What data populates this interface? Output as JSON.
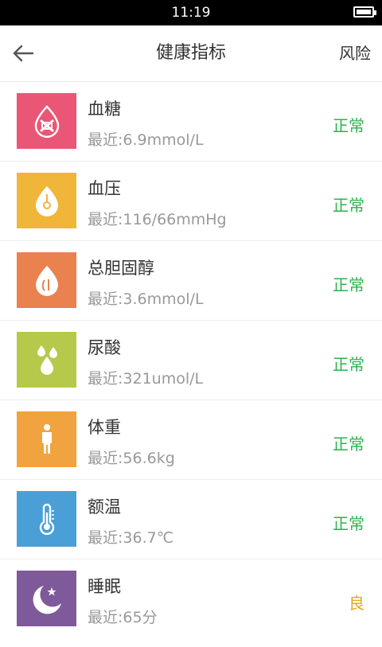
{
  "status_bar": {
    "time": "11:19"
  },
  "header": {
    "title": "健康指标",
    "right_action": "风险"
  },
  "colors": {
    "normal": "#2bb24c",
    "good": "#e6a817"
  },
  "items": [
    {
      "name": "血糖",
      "recent": "最近:6.9mmol/L",
      "status": "正常",
      "tile_color": "#ea5675",
      "icon": "blood-sugar-icon"
    },
    {
      "name": "血压",
      "recent": "最近:116/66mmHg",
      "status": "正常",
      "tile_color": "#f0b63a",
      "icon": "blood-pressure-icon"
    },
    {
      "name": "总胆固醇",
      "recent": "最近:3.6mmol/L",
      "status": "正常",
      "tile_color": "#e9824e",
      "icon": "cholesterol-icon"
    },
    {
      "name": "尿酸",
      "recent": "最近:321umol/L",
      "status": "正常",
      "tile_color": "#b6c94a",
      "icon": "uric-acid-icon"
    },
    {
      "name": "体重",
      "recent": "最近:56.6kg",
      "status": "正常",
      "tile_color": "#f0a33f",
      "icon": "person-icon"
    },
    {
      "name": "额温",
      "recent": "最近:36.7℃",
      "status": "正常",
      "tile_color": "#4a9fd6",
      "icon": "thermometer-icon"
    },
    {
      "name": "睡眠",
      "recent": "最近:65分",
      "status": "良",
      "tile_color": "#7f5a9b",
      "icon": "moon-star-icon"
    }
  ]
}
